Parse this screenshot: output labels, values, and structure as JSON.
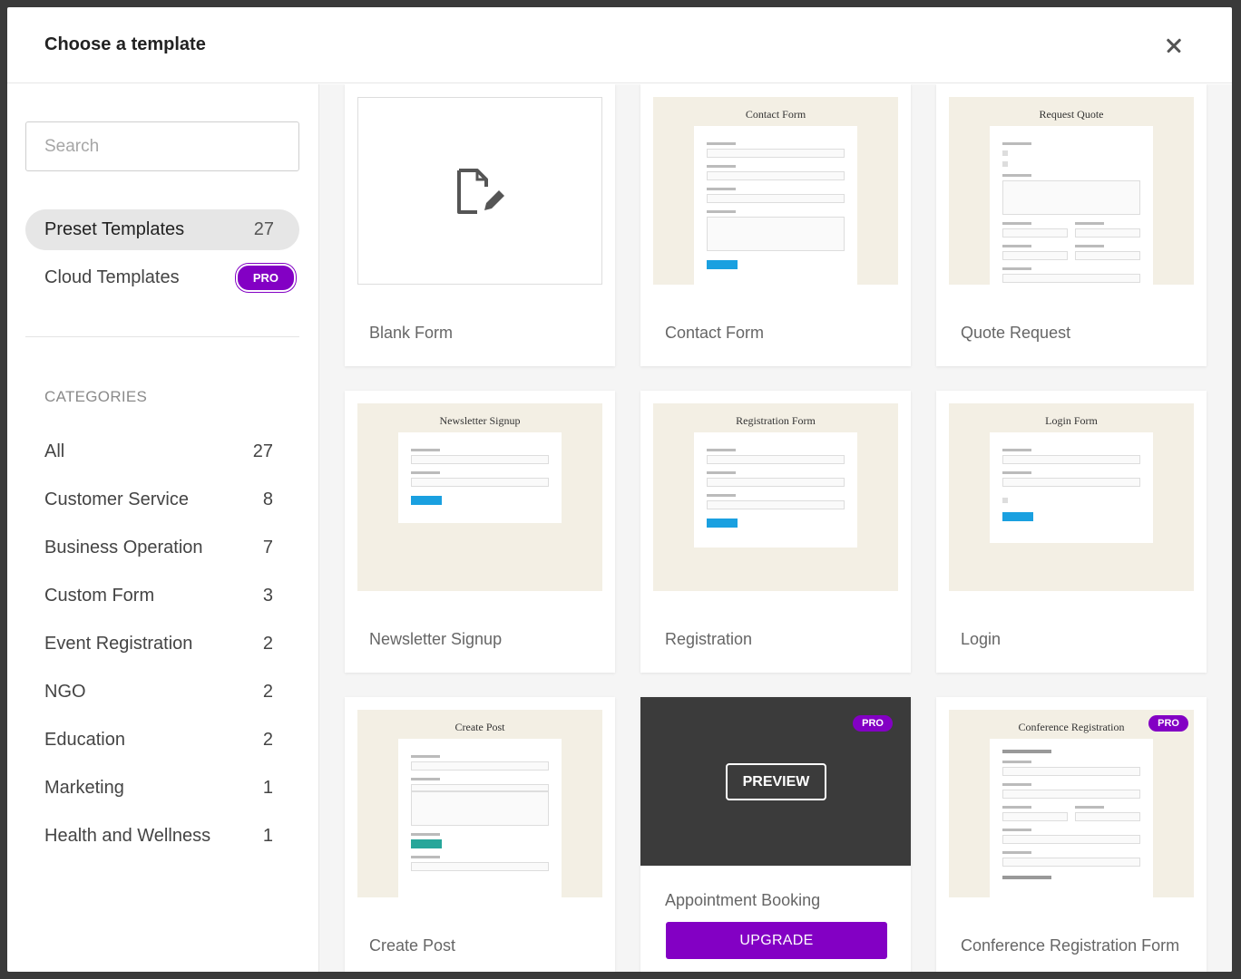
{
  "modal": {
    "title": "Choose a template"
  },
  "search": {
    "placeholder": "Search"
  },
  "sources": [
    {
      "label": "Preset Templates",
      "count": "27"
    },
    {
      "label": "Cloud Templates",
      "badge": "PRO"
    }
  ],
  "categories": {
    "title": "CATEGORIES",
    "items": [
      {
        "label": "All",
        "count": "27"
      },
      {
        "label": "Customer Service",
        "count": "8"
      },
      {
        "label": "Business Operation",
        "count": "7"
      },
      {
        "label": "Custom Form",
        "count": "3"
      },
      {
        "label": "Event Registration",
        "count": "2"
      },
      {
        "label": "NGO",
        "count": "2"
      },
      {
        "label": "Education",
        "count": "2"
      },
      {
        "label": "Marketing",
        "count": "1"
      },
      {
        "label": "Health and Wellness",
        "count": "1"
      }
    ]
  },
  "templates": [
    {
      "label": "Blank Form"
    },
    {
      "label": "Contact Form",
      "thumb_title": "Contact Form"
    },
    {
      "label": "Quote Request",
      "thumb_title": "Request Quote"
    },
    {
      "label": "Newsletter Signup",
      "thumb_title": "Newsletter Signup"
    },
    {
      "label": "Registration",
      "thumb_title": "Registration Form"
    },
    {
      "label": "Login",
      "thumb_title": "Login Form"
    },
    {
      "label": "Create Post",
      "thumb_title": "Create Post"
    },
    {
      "label": "Appointment Booking",
      "badge": "PRO",
      "preview_label": "PREVIEW",
      "upgrade_label": "UPGRADE"
    },
    {
      "label": "Conference Registration Form",
      "thumb_title": "Conference Registration",
      "badge": "PRO"
    }
  ],
  "colors": {
    "accent": "#8300c4",
    "thumb_bg": "#f3efe4",
    "overlay": "#3b3b3b"
  }
}
